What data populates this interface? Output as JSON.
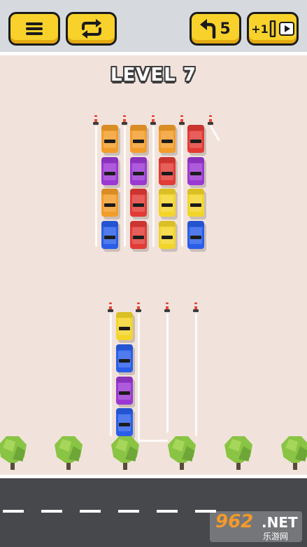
{
  "header": {
    "menu_icon": "hamburger-menu-icon",
    "restart_icon": "restart-arrows-icon",
    "undo_icon": "undo-arrow-icon",
    "undo_count": "5",
    "add_lane_label": "+1",
    "add_lane_icon": "lane-slot-icon",
    "video_icon": "play-video-icon"
  },
  "level_title": "LEVEL 7",
  "colors": {
    "orange": "#f29d2a",
    "purple": "#9b38d3",
    "red": "#e23b36",
    "yellow": "#f3d52a",
    "blue": "#2a5ee8",
    "button_yellow": "#f8d12b",
    "ground": "#f1e3dc",
    "road": "#47484c"
  },
  "top_parking": {
    "columns": [
      [
        "orange",
        "purple",
        "orange",
        "blue"
      ],
      [
        "orange",
        "purple",
        "red",
        "red"
      ],
      [
        "orange",
        "red",
        "yellow",
        "yellow"
      ],
      [
        "red",
        "purple",
        "yellow",
        "blue"
      ]
    ]
  },
  "bottom_parking": {
    "columns": [
      [
        "yellow",
        "blue",
        "purple",
        "blue"
      ],
      [],
      [],
      []
    ]
  },
  "watermark": {
    "number": "962",
    "suffix": ".NET",
    "caption": "乐游网"
  }
}
